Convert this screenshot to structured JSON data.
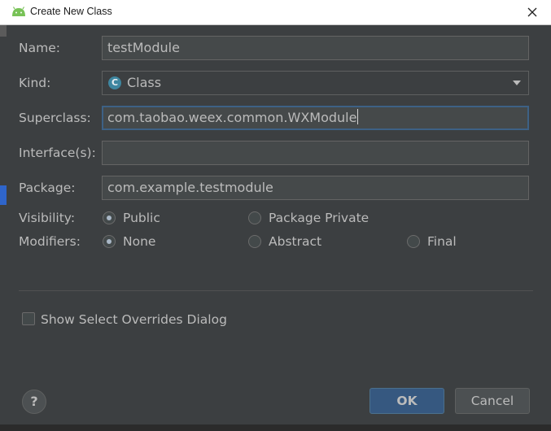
{
  "window": {
    "title": "Create New Class",
    "icon": "android-icon"
  },
  "form": {
    "name_label": "Name:",
    "name_value": "testModule",
    "kind_label": "Kind:",
    "kind_value": "Class",
    "kind_icon_letter": "C",
    "superclass_label": "Superclass:",
    "superclass_value": "com.taobao.weex.common.WXModule",
    "interfaces_label": "Interface(s):",
    "interfaces_value": "",
    "package_label": "Package:",
    "package_value": "com.example.testmodule"
  },
  "visibility": {
    "label": "Visibility:",
    "options": [
      {
        "label": "Public",
        "checked": true
      },
      {
        "label": "Package Private",
        "checked": false
      }
    ]
  },
  "modifiers": {
    "label": "Modifiers:",
    "options": [
      {
        "label": "None",
        "checked": true
      },
      {
        "label": "Abstract",
        "checked": false
      },
      {
        "label": "Final",
        "checked": false
      }
    ]
  },
  "overrides_checkbox": {
    "label": "Show Select Overrides Dialog",
    "checked": false
  },
  "buttons": {
    "help": "?",
    "ok": "OK",
    "cancel": "Cancel"
  },
  "colors": {
    "background": "#3c3f41",
    "accent": "#365880",
    "focus_border": "#3d6185",
    "class_icon": "#3e86a0"
  }
}
